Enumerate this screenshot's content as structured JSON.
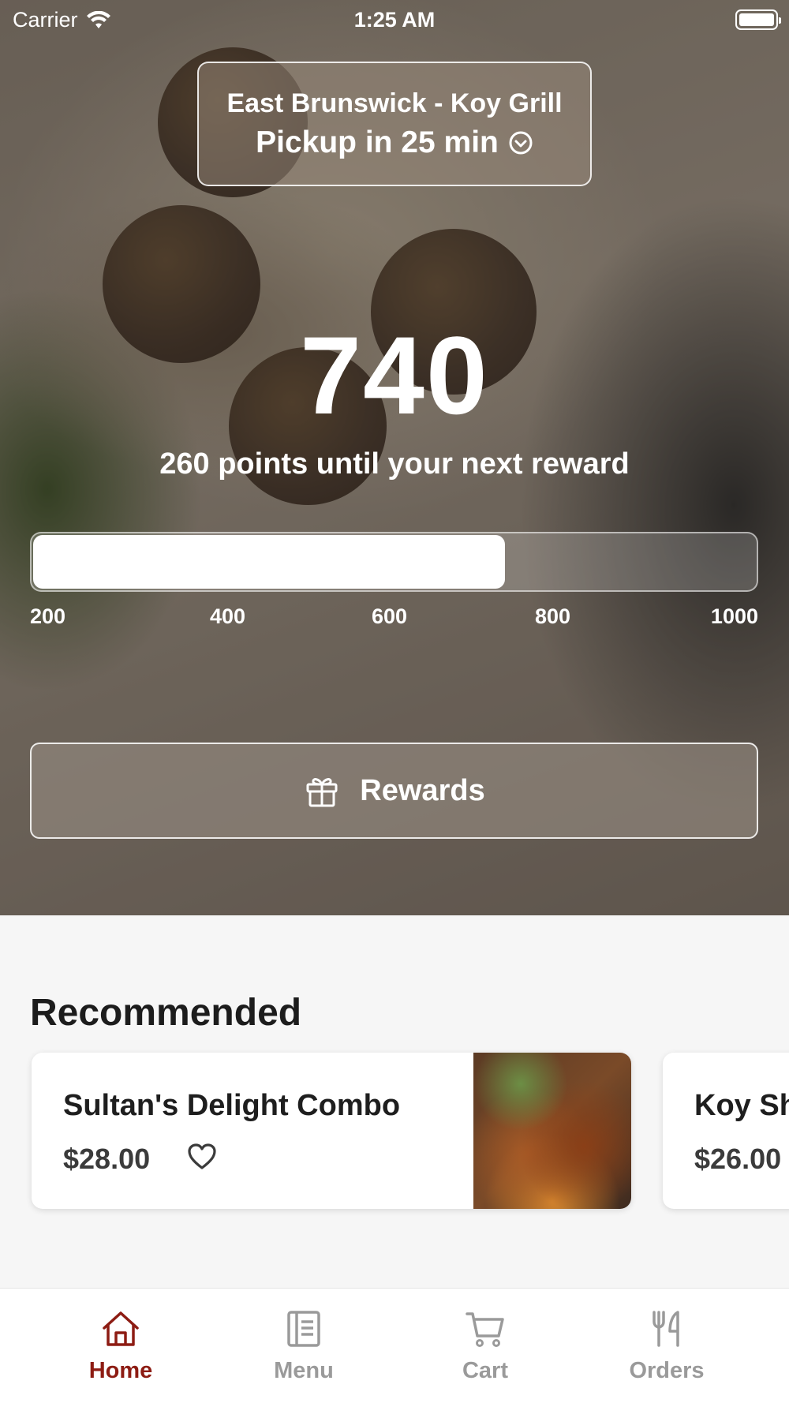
{
  "status_bar": {
    "carrier": "Carrier",
    "time": "1:25 AM"
  },
  "location": {
    "name": "East Brunswick - Koy Grill",
    "pickup": "Pickup in 25 min"
  },
  "rewards": {
    "points": "740",
    "subtitle": "260 points until your next reward",
    "progress_value": 740,
    "progress_min": 200,
    "progress_max": 1000,
    "tick_labels": [
      "200",
      "400",
      "600",
      "800",
      "1000"
    ],
    "button_label": "Rewards"
  },
  "recommended": {
    "title": "Recommended",
    "items": [
      {
        "name": "Sultan's Delight Combo",
        "price": "$28.00"
      },
      {
        "name": "Koy Sh",
        "price": "$26.00"
      }
    ]
  },
  "tabbar": {
    "items": [
      {
        "label": "Home",
        "icon": "home-icon",
        "active": true
      },
      {
        "label": "Menu",
        "icon": "menu-icon",
        "active": false
      },
      {
        "label": "Cart",
        "icon": "cart-icon",
        "active": false
      },
      {
        "label": "Orders",
        "icon": "orders-icon",
        "active": false
      }
    ]
  },
  "colors": {
    "accent": "#8d1c13",
    "inactive": "#9a9a9a"
  }
}
